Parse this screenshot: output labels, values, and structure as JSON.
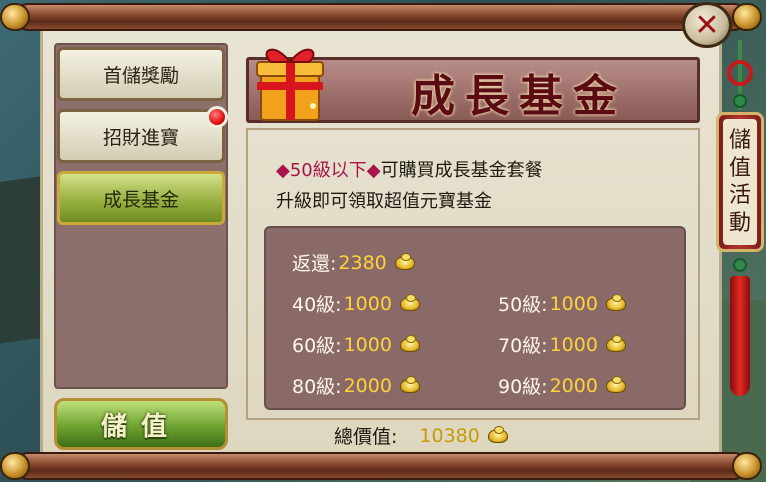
{
  "sidebar": {
    "tabs": [
      {
        "label": "首儲獎勵",
        "active": false,
        "badge": false
      },
      {
        "label": "招財進寶",
        "active": false,
        "badge": true
      },
      {
        "label": "成長基金",
        "active": true,
        "badge": false
      }
    ],
    "store_button_label": "儲值"
  },
  "banner": {
    "title": "成長基金",
    "gift_icon": "gift-box-icon"
  },
  "info": {
    "line1_highlight": "◆50級以下◆",
    "line1_rest": "可購買成長基金套餐",
    "line2": "升級即可領取超值元寶基金"
  },
  "rewards": {
    "rebate_label": "返還:",
    "rebate_value": "2380",
    "levels": [
      {
        "label": "40級:",
        "value": "1000"
      },
      {
        "label": "50級:",
        "value": "1000"
      },
      {
        "label": "60級:",
        "value": "1000"
      },
      {
        "label": "70級:",
        "value": "1000"
      },
      {
        "label": "80級:",
        "value": "2000"
      },
      {
        "label": "90級:",
        "value": "2000"
      }
    ],
    "currency_icon": "gold-ingot-icon"
  },
  "total": {
    "label": "總價值:",
    "value": "10380"
  },
  "side_tag": {
    "chars": [
      "儲",
      "值",
      "活",
      "動"
    ]
  },
  "close_button": {
    "glyph": "✕"
  },
  "colors": {
    "parchment": "#e3ddc8",
    "highlight_text": "#a7154a",
    "gold_value": "#ffd23a",
    "active_tab": "#94ad3c",
    "banner_title": "#5a0c12"
  }
}
